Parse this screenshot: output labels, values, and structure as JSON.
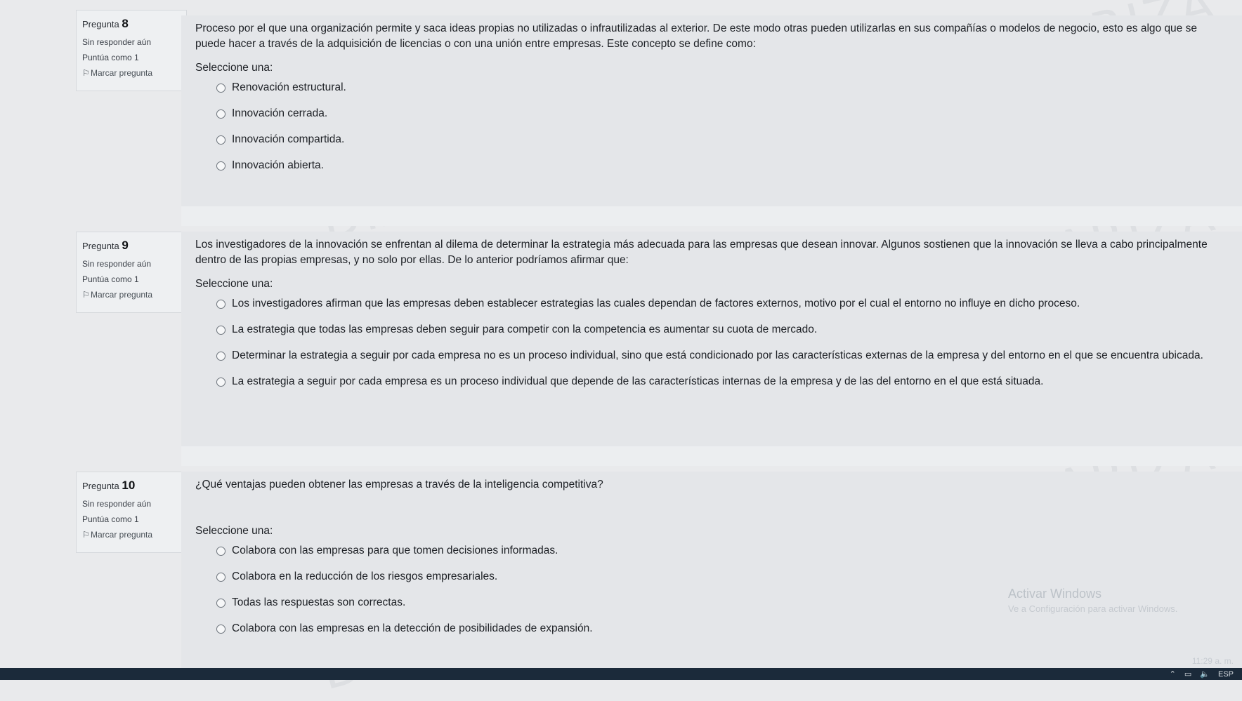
{
  "questions": [
    {
      "number_label": "Pregunta",
      "number": "8",
      "status": "Sin responder aún",
      "points": "Puntúa como 1",
      "flag_label": "Marcar pregunta",
      "text": "Proceso por el que una organización permite y saca ideas propias no utilizadas o infrautilizadas al exterior. De este modo otras pueden utilizarlas en sus compañías o modelos de negocio, esto es algo que se puede hacer a través de la adquisición de licencias o con una unión entre empresas. Este concepto se define como:",
      "prompt": "Seleccione una:",
      "options": [
        "Renovación estructural.",
        "Innovación cerrada.",
        "Innovación compartida.",
        "Innovación abierta."
      ]
    },
    {
      "number_label": "Pregunta",
      "number": "9",
      "status": "Sin responder aún",
      "points": "Puntúa como 1",
      "flag_label": "Marcar pregunta",
      "text": "Los investigadores de la innovación se enfrentan al dilema de determinar la estrategia más adecuada para las empresas que desean innovar. Algunos sostienen que la innovación se lleva a cabo principalmente dentro de las propias empresas, y no solo por ellas. De lo anterior podríamos afirmar que:",
      "prompt": "Seleccione una:",
      "options": [
        "Los investigadores afirman que las empresas deben establecer estrategias las cuales dependan de factores externos, motivo por el cual el entorno no influye en dicho proceso.",
        "La estrategia que todas las empresas deben seguir para competir con la competencia es aumentar su cuota de mercado.",
        "Determinar la estrategia a seguir por cada empresa no es un proceso individual, sino que está condicionado por las características externas de la empresa y del entorno en el que se encuentra ubicada.",
        "La estrategia a seguir por cada empresa es un proceso individual que depende de las características internas de la empresa y de las del entorno en el que está situada."
      ]
    },
    {
      "number_label": "Pregunta",
      "number": "10",
      "status": "Sin responder aún",
      "points": "Puntúa como 1",
      "flag_label": "Marcar pregunta",
      "text": "¿Qué ventajas pueden obtener las empresas a través de la inteligencia competitiva?",
      "prompt": "Seleccione una:",
      "options": [
        "Colabora con las empresas para que tomen decisiones informadas.",
        "Colabora en la reducción de los riesgos empresariales.",
        "Todas las respuestas son correctas.",
        "Colabora con las empresas en la detección de posibilidades de expansión."
      ]
    }
  ],
  "watermark": [
    "DIANA CAROLINA VANEGAS ARIZA",
    "DIANA CAROLINA VANEGAS ARIZA",
    "DIANA CAROLINA VANEGAS ARIZA"
  ],
  "system": {
    "activate_title": "Activar Windows",
    "activate_sub": "Ve a Configuración para activar Windows.",
    "lang": "ESP",
    "time": "11:29 a. m."
  }
}
